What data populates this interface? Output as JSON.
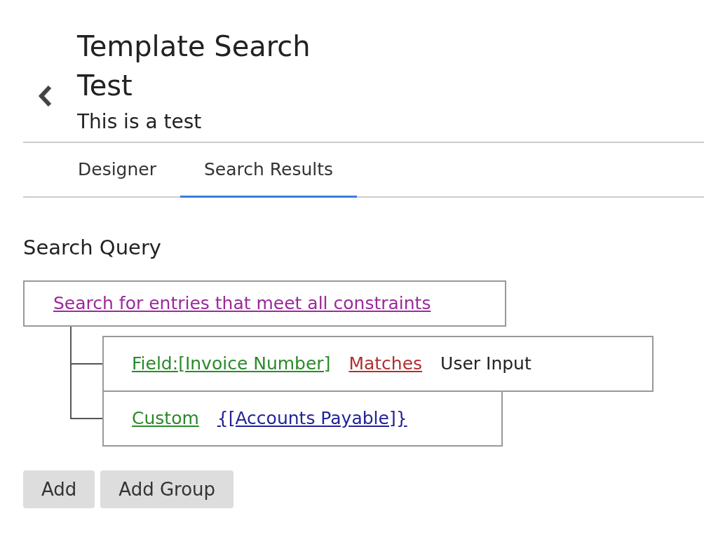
{
  "header": {
    "title": "Template Search Test",
    "subtitle": "This is a test"
  },
  "tabs": [
    {
      "label": "Designer",
      "selected": false
    },
    {
      "label": "Search Results",
      "selected": true
    }
  ],
  "section_title": "Search Query",
  "query": {
    "root": "Search for entries that meet all constraints",
    "conditions": [
      {
        "parts": [
          {
            "kind": "field",
            "text": "Field:[Invoice Number]"
          },
          {
            "kind": "operator",
            "text": "Matches"
          },
          {
            "kind": "value",
            "text": "User Input"
          }
        ]
      },
      {
        "parts": [
          {
            "kind": "field",
            "text": "Custom"
          },
          {
            "kind": "expression",
            "text": "{[Accounts Payable]}"
          }
        ]
      }
    ]
  },
  "buttons": [
    "Add",
    "Add Group"
  ]
}
